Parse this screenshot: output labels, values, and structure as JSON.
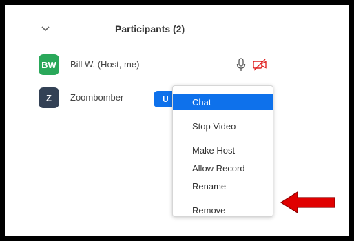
{
  "panel": {
    "title": "Participants (2)",
    "collapse_icon": "chevron-down-icon"
  },
  "participants": [
    {
      "initials": "BW",
      "name": "Bill W. (Host, me)",
      "avatar_color": "#2aa85a",
      "mic_icon": "microphone-icon",
      "video_icon": "video-off-icon"
    },
    {
      "initials": "Z",
      "name": "Zoombomber",
      "avatar_color": "#334155",
      "more_button_label": "U"
    }
  ],
  "context_menu": {
    "items": [
      "Chat",
      "Stop Video",
      "Make Host",
      "Allow Record",
      "Rename",
      "Remove"
    ],
    "highlighted": "Chat"
  },
  "annotation": {
    "icon": "red-arrow-icon",
    "color": "#e00000"
  },
  "colors": {
    "accent": "#0e71eb",
    "video_off": "#e02424"
  }
}
